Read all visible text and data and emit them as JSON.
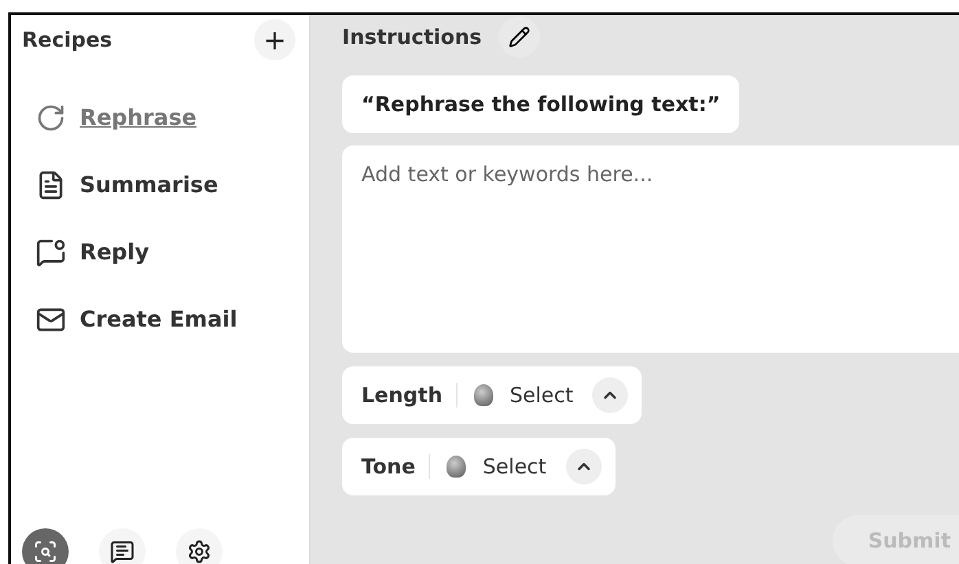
{
  "sidebar": {
    "title": "Recipes",
    "add_button": "+",
    "items": [
      {
        "kind": "rephrase",
        "label": "Rephrase",
        "selected": true
      },
      {
        "kind": "summarise",
        "label": "Summarise",
        "selected": false
      },
      {
        "kind": "reply",
        "label": "Reply",
        "selected": false
      },
      {
        "kind": "email",
        "label": "Create Email",
        "selected": false
      }
    ],
    "bottom_icons": [
      {
        "kind": "lens",
        "selected": true
      },
      {
        "kind": "chat",
        "selected": false
      },
      {
        "kind": "settings",
        "selected": false
      }
    ]
  },
  "main": {
    "title": "Instructions",
    "prompt": "“Rephrase the following text:”",
    "input": {
      "placeholder": "Add text or keywords here..."
    },
    "options": [
      {
        "label": "Length",
        "value": "Select",
        "expanded": true
      },
      {
        "label": "Tone",
        "value": "Select",
        "expanded": true
      }
    ],
    "submit": {
      "label": "Submit",
      "disabled": true
    }
  }
}
